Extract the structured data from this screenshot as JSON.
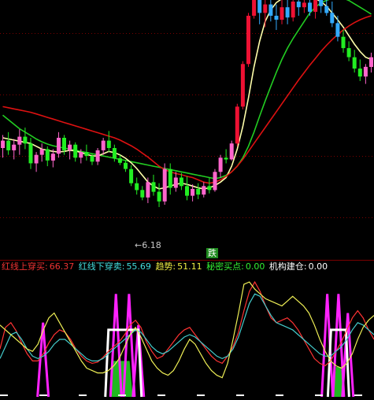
{
  "colors": {
    "bg": "#000000",
    "grid": "#7a0000",
    "up": "#ff66cc",
    "up_strong": "#ee1133",
    "down": "#22ee22",
    "down_blue": "#33aaff",
    "ma_red": "#dd1111",
    "ma_green": "#22cc22",
    "ma_yellow": "#ffffaa",
    "sub_red": "#ff3333",
    "sub_cyan": "#44cccc",
    "sub_yellow": "#eeee55",
    "sub_magenta": "#ff22ff",
    "sub_white": "#ffffff"
  },
  "price_panel": {
    "low_label": "6.18",
    "signal_label": "跌"
  },
  "indicator_legend": [
    {
      "label": "红线上穿买:",
      "value": "66.37",
      "color": "#ee3333"
    },
    {
      "label": "红线下穿卖:",
      "value": "55.69",
      "color": "#44dddd"
    },
    {
      "label": "趋势:",
      "value": "51.11",
      "color": "#eeee44"
    },
    {
      "label": "秘密买点:",
      "value": "0.00",
      "color": "#33ee33"
    },
    {
      "label": "机构建仓:",
      "value": "0.00",
      "color": "#ffffff"
    }
  ],
  "chart_data": [
    {
      "type": "candlestick",
      "price_range": [
        5.5,
        9.8
      ],
      "low_marker": 6.18,
      "candles": [
        [
          7.22,
          7.45,
          7.05,
          7.35
        ],
        [
          7.35,
          7.5,
          7.1,
          7.18
        ],
        [
          7.18,
          7.38,
          7.02,
          7.28
        ],
        [
          7.28,
          7.55,
          7.1,
          7.42
        ],
        [
          7.42,
          7.58,
          7.2,
          7.3
        ],
        [
          7.3,
          7.4,
          6.85,
          6.95
        ],
        [
          6.95,
          7.15,
          6.8,
          7.1
        ],
        [
          7.1,
          7.3,
          6.98,
          7.2
        ],
        [
          7.2,
          7.25,
          6.9,
          7.0
        ],
        [
          7.0,
          7.2,
          6.88,
          7.12
        ],
        [
          7.12,
          7.5,
          7.05,
          7.4
        ],
        [
          7.4,
          7.45,
          7.1,
          7.18
        ],
        [
          7.18,
          7.35,
          7.02,
          7.28
        ],
        [
          7.28,
          7.32,
          6.98,
          7.05
        ],
        [
          7.05,
          7.2,
          6.95,
          7.15
        ],
        [
          7.15,
          7.28,
          7.0,
          7.08
        ],
        [
          7.08,
          7.12,
          6.92,
          6.98
        ],
        [
          6.98,
          7.22,
          6.92,
          7.18
        ],
        [
          7.18,
          7.4,
          7.1,
          7.35
        ],
        [
          7.35,
          7.52,
          7.15,
          7.22
        ],
        [
          7.22,
          7.28,
          6.98,
          7.04
        ],
        [
          7.04,
          7.1,
          6.92,
          6.96
        ],
        [
          6.96,
          7.0,
          6.8,
          6.85
        ],
        [
          6.85,
          6.92,
          6.55,
          6.6
        ],
        [
          6.6,
          6.7,
          6.4,
          6.48
        ],
        [
          6.48,
          6.55,
          6.3,
          6.35
        ],
        [
          6.35,
          6.7,
          6.25,
          6.62
        ],
        [
          6.62,
          6.75,
          6.38,
          6.45
        ],
        [
          6.45,
          6.6,
          6.18,
          6.28
        ],
        [
          6.28,
          6.95,
          6.22,
          6.85
        ],
        [
          6.85,
          6.95,
          6.4,
          6.52
        ],
        [
          6.52,
          6.8,
          6.45,
          6.7
        ],
        [
          6.7,
          6.78,
          6.48,
          6.55
        ],
        [
          6.55,
          6.72,
          6.3,
          6.38
        ],
        [
          6.38,
          6.58,
          6.28,
          6.5
        ],
        [
          6.5,
          6.6,
          6.32,
          6.4
        ],
        [
          6.4,
          6.62,
          6.35,
          6.55
        ],
        [
          6.55,
          6.7,
          6.42,
          6.48
        ],
        [
          6.48,
          6.85,
          6.45,
          6.8
        ],
        [
          6.8,
          7.1,
          6.7,
          7.05
        ],
        [
          7.05,
          7.2,
          6.95,
          7.02
        ],
        [
          7.02,
          7.35,
          7.0,
          7.3
        ],
        [
          7.3,
          8.0,
          7.25,
          7.95
        ],
        [
          7.95,
          8.75,
          7.9,
          8.7
        ],
        [
          8.7,
          9.6,
          8.65,
          9.55
        ],
        [
          9.55,
          9.9,
          9.5,
          9.85
        ],
        [
          9.85,
          9.95,
          9.4,
          9.6
        ],
        [
          9.6,
          9.95,
          9.35,
          9.75
        ],
        [
          9.75,
          9.9,
          9.45,
          9.55
        ],
        [
          9.55,
          9.75,
          9.3,
          9.48
        ],
        [
          9.48,
          9.9,
          9.4,
          9.7
        ],
        [
          9.7,
          9.85,
          9.4,
          9.52
        ],
        [
          9.52,
          9.95,
          9.45,
          9.8
        ],
        [
          9.8,
          9.95,
          9.55,
          9.7
        ],
        [
          9.7,
          9.92,
          9.6,
          9.78
        ],
        [
          9.78,
          9.95,
          9.55,
          9.62
        ],
        [
          9.62,
          9.9,
          9.5,
          9.85
        ],
        [
          9.85,
          9.95,
          9.6,
          9.72
        ],
        [
          9.72,
          9.92,
          9.55,
          9.6
        ],
        [
          9.6,
          9.8,
          9.35,
          9.42
        ],
        [
          9.42,
          9.55,
          9.1,
          9.18
        ],
        [
          9.18,
          9.3,
          8.9,
          8.98
        ],
        [
          8.98,
          9.1,
          8.75,
          8.82
        ],
        [
          8.82,
          8.95,
          8.55,
          8.62
        ],
        [
          8.62,
          8.78,
          8.4,
          8.48
        ],
        [
          8.48,
          8.7,
          8.35,
          8.65
        ],
        [
          8.65,
          8.9,
          8.55,
          8.82
        ]
      ],
      "ma_red": [
        7.95,
        7.93,
        7.91,
        7.89,
        7.87,
        7.85,
        7.82,
        7.79,
        7.76,
        7.73,
        7.7,
        7.67,
        7.64,
        7.61,
        7.58,
        7.55,
        7.52,
        7.49,
        7.46,
        7.43,
        7.4,
        7.36,
        7.31,
        7.26,
        7.2,
        7.13,
        7.06,
        6.98,
        6.9,
        6.84,
        6.8,
        6.77,
        6.75,
        6.72,
        6.7,
        6.66,
        6.62,
        6.6,
        6.62,
        6.66,
        6.72,
        6.8,
        6.9,
        7.02,
        7.16,
        7.3,
        7.44,
        7.58,
        7.72,
        7.86,
        8.0,
        8.14,
        8.28,
        8.42,
        8.55,
        8.68,
        8.8,
        8.92,
        9.03,
        9.13,
        9.22,
        9.3,
        9.37,
        9.43,
        9.48,
        9.52,
        9.55
      ],
      "ma_green": [
        7.8,
        7.72,
        7.64,
        7.56,
        7.5,
        7.44,
        7.38,
        7.33,
        7.29,
        7.26,
        7.24,
        7.22,
        7.2,
        7.18,
        7.16,
        7.14,
        7.12,
        7.1,
        7.08,
        7.06,
        7.04,
        7.02,
        7.0,
        6.98,
        6.96,
        6.94,
        6.92,
        6.9,
        6.88,
        6.86,
        6.84,
        6.82,
        6.8,
        6.78,
        6.76,
        6.74,
        6.72,
        6.7,
        6.68,
        6.7,
        6.74,
        6.8,
        6.9,
        7.05,
        7.25,
        7.5,
        7.78,
        8.05,
        8.3,
        8.55,
        8.78,
        8.98,
        9.15,
        9.3,
        9.45,
        9.6,
        9.7,
        9.78,
        9.82,
        9.86,
        9.88,
        9.86,
        9.82,
        9.76,
        9.7,
        9.64,
        9.58
      ],
      "ma_yellow": [
        7.4,
        7.38,
        7.36,
        7.34,
        7.32,
        7.3,
        7.25,
        7.2,
        7.18,
        7.16,
        7.15,
        7.16,
        7.18,
        7.17,
        7.14,
        7.11,
        7.08,
        7.08,
        7.12,
        7.16,
        7.14,
        7.1,
        7.04,
        6.96,
        6.86,
        6.74,
        6.62,
        6.55,
        6.5,
        6.52,
        6.55,
        6.58,
        6.6,
        6.58,
        6.55,
        6.52,
        6.5,
        6.52,
        6.56,
        6.62,
        6.7,
        6.9,
        7.2,
        7.6,
        8.1,
        8.65,
        9.1,
        9.45,
        9.65,
        9.78,
        9.85,
        9.9,
        9.93,
        9.92,
        9.9,
        9.88,
        9.85,
        9.8,
        9.72,
        9.6,
        9.48,
        9.35,
        9.2,
        9.05,
        8.92,
        8.82,
        8.78
      ]
    },
    {
      "type": "line",
      "y_range": [
        0,
        100
      ],
      "series": [
        {
          "name": "红线上穿买",
          "color": "#ff3333",
          "values": [
            40,
            58,
            62,
            55,
            45,
            36,
            30,
            30,
            36,
            45,
            52,
            56,
            54,
            48,
            40,
            34,
            30,
            28,
            29,
            33,
            38,
            42,
            46,
            52,
            60,
            64,
            58,
            46,
            38,
            32,
            34,
            40,
            46,
            52,
            56,
            58,
            52,
            46,
            40,
            34,
            30,
            28,
            34,
            42,
            54,
            72,
            88,
            96,
            88,
            76,
            66,
            62,
            64,
            66,
            62,
            56,
            48,
            40,
            32,
            28,
            26,
            30,
            38,
            46,
            56,
            66,
            72,
            66,
            56,
            48
          ]
        },
        {
          "name": "红线下穿卖",
          "color": "#44cccc",
          "values": [
            32,
            42,
            52,
            54,
            48,
            40,
            34,
            32,
            34,
            38,
            44,
            48,
            48,
            44,
            40,
            36,
            32,
            30,
            30,
            32,
            36,
            40,
            44,
            48,
            52,
            56,
            54,
            48,
            42,
            38,
            36,
            38,
            42,
            46,
            50,
            52,
            50,
            46,
            42,
            38,
            34,
            32,
            34,
            40,
            50,
            64,
            78,
            86,
            84,
            76,
            68,
            62,
            60,
            58,
            56,
            52,
            48,
            44,
            40,
            36,
            34,
            34,
            38,
            42,
            48,
            56,
            62,
            60,
            56,
            52
          ]
        },
        {
          "name": "趋势",
          "color": "#eeee55",
          "values": [
            60,
            56,
            52,
            48,
            44,
            40,
            38,
            44,
            56,
            66,
            70,
            62,
            54,
            46,
            38,
            30,
            24,
            22,
            20,
            20,
            22,
            26,
            32,
            42,
            52,
            58,
            50,
            40,
            30,
            24,
            20,
            18,
            22,
            30,
            40,
            48,
            44,
            36,
            28,
            22,
            18,
            16,
            28,
            48,
            70,
            94,
            96,
            90,
            86,
            82,
            80,
            78,
            76,
            80,
            84,
            80,
            76,
            70,
            60,
            48,
            38,
            30,
            26,
            24,
            28,
            36,
            48,
            58,
            64,
            68
          ]
        },
        {
          "name": "秘密买点",
          "color": "#33ee33",
          "values": [
            0,
            0,
            0,
            0,
            0,
            0,
            0,
            0,
            0,
            0,
            0,
            0,
            0,
            0,
            0,
            0,
            0,
            0,
            0,
            0,
            0,
            0,
            0,
            0,
            0,
            0,
            0,
            0,
            0,
            0,
            0,
            0,
            0,
            0,
            0,
            0,
            0,
            0,
            0,
            0,
            0,
            0,
            0,
            0,
            0,
            0,
            0,
            0,
            0,
            0,
            0,
            0,
            0,
            0,
            0,
            0,
            0,
            0,
            0,
            0,
            0,
            0,
            0,
            0,
            0,
            0,
            0,
            0,
            0,
            0
          ]
        },
        {
          "name": "机构建仓",
          "color": "#ffffff",
          "values": [
            0,
            0,
            0,
            0,
            0,
            0,
            0,
            0,
            0,
            0,
            0,
            0,
            0,
            0,
            0,
            0,
            0,
            0,
            0,
            0,
            0,
            0,
            0,
            0,
            0,
            0,
            0,
            0,
            0,
            0,
            0,
            0,
            0,
            0,
            0,
            0,
            0,
            0,
            0,
            0,
            0,
            0,
            0,
            0,
            0,
            0,
            0,
            0,
            0,
            0,
            0,
            0,
            0,
            0,
            0,
            0,
            0,
            0,
            0,
            0,
            0,
            0,
            0,
            0,
            0,
            0,
            0,
            0,
            0,
            0
          ]
        }
      ],
      "magenta_spikes": [
        {
          "x": 0.115,
          "height": 0.62
        },
        {
          "x": 0.31,
          "height": 0.86
        },
        {
          "x": 0.345,
          "height": 0.86
        },
        {
          "x": 0.37,
          "height": 0.6
        },
        {
          "x": 0.875,
          "height": 0.86
        },
        {
          "x": 0.905,
          "height": 0.86
        },
        {
          "x": 0.93,
          "height": 0.7
        }
      ],
      "white_boxes": [
        {
          "x0": 0.29,
          "x1": 0.37,
          "height": 0.56
        },
        {
          "x0": 0.885,
          "x1": 0.925,
          "height": 0.56
        }
      ],
      "green_fills": [
        {
          "x0": 0.295,
          "x1": 0.355,
          "height": 0.3
        },
        {
          "x0": 0.89,
          "x1": 0.92,
          "height": 0.25
        }
      ]
    }
  ]
}
